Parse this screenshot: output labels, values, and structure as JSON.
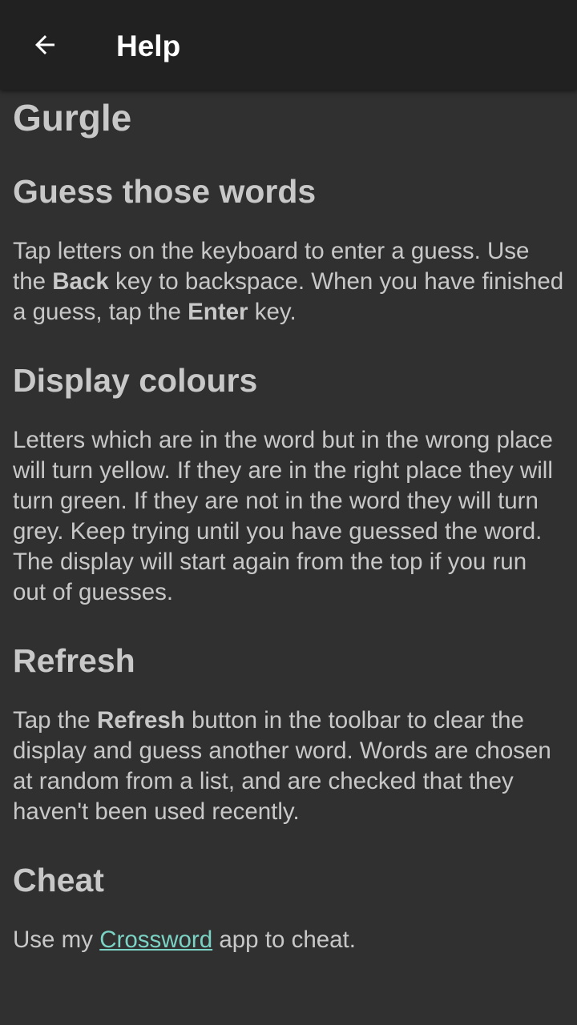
{
  "appbar": {
    "back_icon": "arrow-back-icon",
    "title": "Help"
  },
  "content": {
    "title": "Gurgle",
    "sections": [
      {
        "heading": "Guess those words",
        "parts": [
          "Tap letters on the keyboard to enter a guess. Use the ",
          "Back",
          " key to backspace. When you have finished a guess, tap the ",
          "Enter",
          " key."
        ]
      },
      {
        "heading": "Display colours",
        "text": "Letters which are in the word but in the wrong place will turn yellow. If they are in the right place they will turn green. If they are not in the word they will turn grey. Keep trying until you have guessed the word. The display will start again from the top if you run out of guesses."
      },
      {
        "heading": "Refresh",
        "parts": [
          "Tap the ",
          "Refresh",
          " button in the toolbar to clear the display and guess another word. Words are chosen at random from a list, and are checked that they haven't been used recently."
        ]
      },
      {
        "heading": "Cheat",
        "parts": [
          "Use my ",
          "Crossword",
          " app to cheat."
        ]
      }
    ]
  },
  "colors": {
    "background": "#303030",
    "appbar": "#212121",
    "text": "#c8c8c8",
    "link": "#7ad3c4"
  }
}
